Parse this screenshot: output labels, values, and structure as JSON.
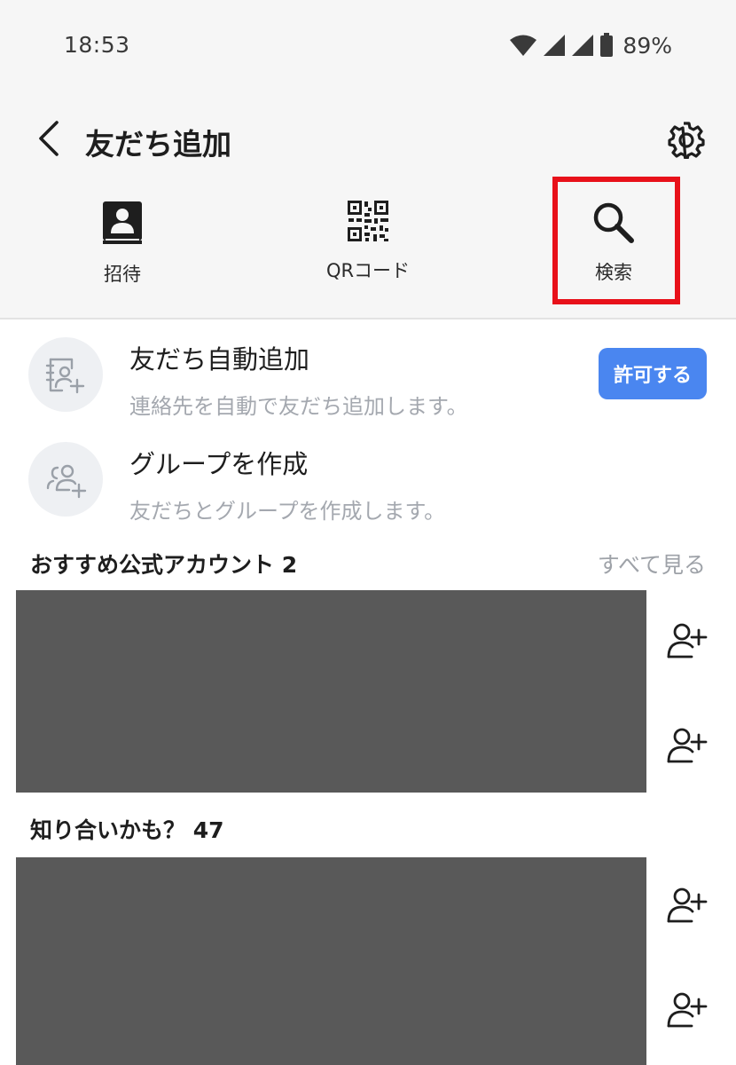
{
  "status_bar": {
    "time": "18:53",
    "battery_percent": "89%",
    "icons": [
      "wifi-icon",
      "signal-icon",
      "signal-icon",
      "battery-icon"
    ]
  },
  "header": {
    "title": "友だち追加",
    "back_icon": "chevron-left-icon",
    "settings_icon": "gear-icon"
  },
  "add_methods": [
    {
      "label": "招待",
      "icon": "contact-book-icon"
    },
    {
      "label": "QRコード",
      "icon": "qr-code-icon"
    },
    {
      "label": "検索",
      "icon": "search-icon",
      "highlighted": true
    }
  ],
  "features": [
    {
      "title": "友だち自動追加",
      "subtitle": "連絡先を自動で友だち追加します。",
      "button_label": "許可する",
      "icon": "contact-add-icon"
    },
    {
      "title": "グループを作成",
      "subtitle": "友だちとグループを作成します。",
      "icon": "group-add-icon"
    }
  ],
  "sections": {
    "official": {
      "title": "おすすめ公式アカウント 2",
      "see_all": "すべて見る"
    },
    "maybe_know": {
      "title": "知り合いかも？ 47"
    }
  },
  "colors": {
    "accent_blue": "#4a86f0",
    "highlight_red": "#e8111a",
    "redacted_gray": "#595959"
  }
}
